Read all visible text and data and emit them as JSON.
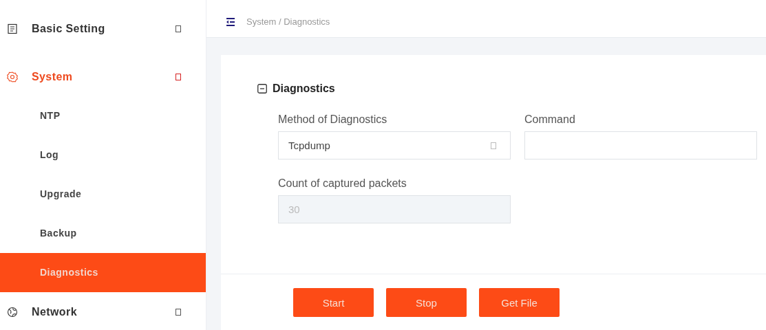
{
  "sidebar": {
    "items": [
      {
        "label": "Basic Setting",
        "kind": "doc",
        "selected": false
      },
      {
        "label": "System",
        "kind": "gear",
        "selected": true,
        "children": [
          {
            "label": "NTP",
            "selected": false
          },
          {
            "label": "Log",
            "selected": false
          },
          {
            "label": "Upgrade",
            "selected": false
          },
          {
            "label": "Backup",
            "selected": false
          },
          {
            "label": "Diagnostics",
            "selected": true
          }
        ]
      },
      {
        "label": "Network",
        "kind": "globe",
        "selected": false
      }
    ]
  },
  "breadcrumb": "System / Diagnostics",
  "section": {
    "title": "Diagnostics",
    "expanded": true
  },
  "fields": [
    {
      "label": "Method of Diagnostics",
      "kind": "select",
      "value": "Tcpdump",
      "disabled": false
    },
    {
      "label": "Command",
      "kind": "text",
      "disabled": false
    },
    {
      "label": "Count of captured packets",
      "kind": "text",
      "value": "30",
      "disabled": true
    }
  ],
  "buttons": [
    "Start",
    "Stop",
    "Get File"
  ]
}
